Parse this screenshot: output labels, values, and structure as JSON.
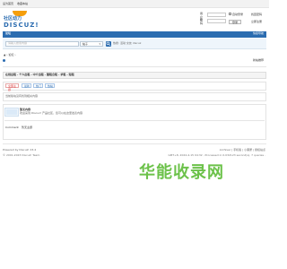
{
  "topbar": {
    "links": [
      "设为首页",
      "收藏本站"
    ]
  },
  "logo": {
    "cn_text": "社区动力",
    "en_text": "DISCUZ!"
  },
  "login": {
    "user_label": "用户名",
    "password_label": "密码",
    "auto_login": "自动登录",
    "forgot_password": "找回密码",
    "login_button": "登录",
    "register_button": "立即注册"
  },
  "navbar": {
    "item": "论坛",
    "quicknav": "快捷导航"
  },
  "search": {
    "placeholder": "请输入搜索内容",
    "scope": "帖子",
    "hot_label": "热搜: 活动 交友 discuz"
  },
  "breadcrumb": "▲ › 论坛 ›",
  "breadcrumb_right": "新帖推荐",
  "thread_title": "在线出租 - 个人出租 - 中介出租 - 整租合租 - 求租 - 短租",
  "tabs": [
    {
      "label": "全部主题",
      "color": "#d33"
    },
    {
      "label": "最新",
      "color": "#2b6cb0"
    },
    {
      "label": "热门",
      "color": "#2b6cb0"
    },
    {
      "label": "热帖",
      "color": "#2b6cb0"
    }
  ],
  "notice": "当前版块没有找到相关内容",
  "post": {
    "title": "暂无内容",
    "subtitle": "欢迎来到 Discuz! 产品社区，您可以在这里发表内容",
    "stat_label": "Comment",
    "stat_value": "暂无主题"
  },
  "footer": {
    "left1": "Powered by Discuz! X3.4",
    "left2": "© 2001-2023 Discuz! Team.",
    "right1": "Archiver | 手机版 | 小黑屋 | 授权站点",
    "right2": "GMT+8, 2024-4-15 04:32 , Processed in 0.032123 second(s), 7 queries ."
  },
  "watermark": "华能收录网"
}
